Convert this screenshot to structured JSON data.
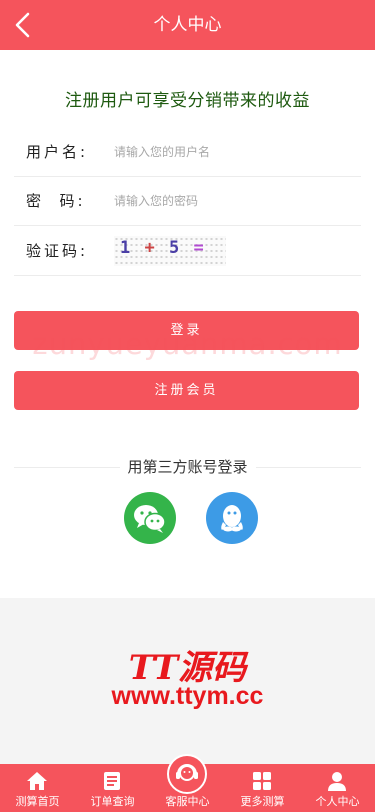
{
  "header": {
    "title": "个人中心",
    "back_icon": "chevron-left-icon"
  },
  "slogan": "注册用户可享受分销带来的收益",
  "form": {
    "username": {
      "label": "用户名:",
      "placeholder": "请输入您的用户名"
    },
    "password": {
      "label": "密  码:",
      "placeholder": "请输入您的密码"
    },
    "captcha": {
      "label": "验证码:",
      "expression_a": "1",
      "operator": "+",
      "expression_b": "5",
      "equals": "="
    }
  },
  "buttons": {
    "login": "登录",
    "register": "注册会员"
  },
  "third_party": {
    "title": "用第三方账号登录",
    "providers": [
      "wechat-icon",
      "qq-icon"
    ]
  },
  "watermark": "zunyueyuanma.com",
  "brand": {
    "name": "TT源码",
    "url": "www.ttym.cc"
  },
  "tabbar": [
    {
      "label": "测算首页",
      "icon": "home-icon"
    },
    {
      "label": "订单查询",
      "icon": "document-icon"
    },
    {
      "label": "客服中心",
      "icon": "headset-icon"
    },
    {
      "label": "更多测算",
      "icon": "grid-icon"
    },
    {
      "label": "个人中心",
      "icon": "user-icon"
    }
  ],
  "colors": {
    "primary": "#f5545c",
    "slogan": "#1e5a10",
    "brand": "#e8191e"
  }
}
